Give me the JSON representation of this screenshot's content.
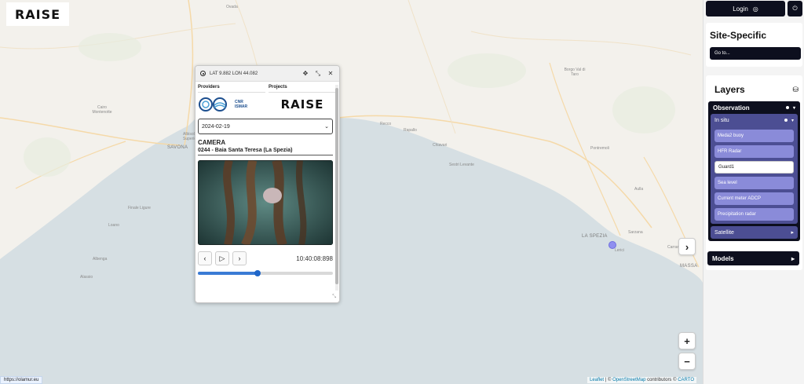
{
  "app": {
    "logo_text": "RAISE",
    "status_url": "https://olamur.eu"
  },
  "map": {
    "labels": [
      {
        "text": "Ovada",
        "cls": ""
      },
      {
        "text": "Borgo Val di Taro",
        "cls": ""
      },
      {
        "text": "Cairo Montenotte",
        "cls": ""
      },
      {
        "text": "SAVONA",
        "cls": "big"
      },
      {
        "text": "Albisola Superiore",
        "cls": ""
      },
      {
        "text": "Rapallo",
        "cls": ""
      },
      {
        "text": "Recco",
        "cls": ""
      },
      {
        "text": "Chiavari",
        "cls": ""
      },
      {
        "text": "Sestri Levante",
        "cls": ""
      },
      {
        "text": "Finale Ligure",
        "cls": ""
      },
      {
        "text": "Loano",
        "cls": ""
      },
      {
        "text": "Albenga",
        "cls": ""
      },
      {
        "text": "Alassio",
        "cls": ""
      },
      {
        "text": "Aulla",
        "cls": ""
      },
      {
        "text": "Sarzana",
        "cls": ""
      },
      {
        "text": "LA SPEZIA",
        "cls": "big"
      },
      {
        "text": "Lerici",
        "cls": ""
      },
      {
        "text": "MASSA",
        "cls": "big"
      },
      {
        "text": "Carrara",
        "cls": ""
      },
      {
        "text": "Pontremoli",
        "cls": ""
      }
    ],
    "zoom_in": "+",
    "zoom_out": "−",
    "next_arrow": "›",
    "attribution": {
      "leaflet": "Leaflet",
      "sep": " | © ",
      "osm": "OpenStreetMap",
      "contrib": " contributors © ",
      "carto": "CARTO"
    }
  },
  "popup": {
    "coords": "LAT 9.882 LON 44.082",
    "providers_title": "Providers",
    "projects_title": "Projects",
    "provider_logo_text": "CNR ISMAR",
    "project_logo_text": "RAISE",
    "date_value": "2024-02-19",
    "section": "CAMERA",
    "station": "0244 - Baia Santa Teresa (La Spezia)",
    "timestamp": "10:40:08:898",
    "progress": 0.44,
    "icons": [
      "radio-icon",
      "move-icon",
      "collapse-icon",
      "close-icon"
    ]
  },
  "panel": {
    "login_label": "Login",
    "site_specific_title": "Site-Specific",
    "goto_label": "Go to...",
    "layers_title": "Layers",
    "observation_label": "Observation",
    "insitu_label": "In situ",
    "layer_items": [
      {
        "label": "Meda2 buoy",
        "active": false
      },
      {
        "label": "HFR Radar",
        "active": false
      },
      {
        "label": "Guard1",
        "active": true
      },
      {
        "label": "Sea level",
        "active": false
      },
      {
        "label": "Current meter ADCP",
        "active": false
      },
      {
        "label": "Precipitation radar",
        "active": false
      }
    ],
    "satellite_label": "Satellite",
    "models_label": "Models"
  }
}
